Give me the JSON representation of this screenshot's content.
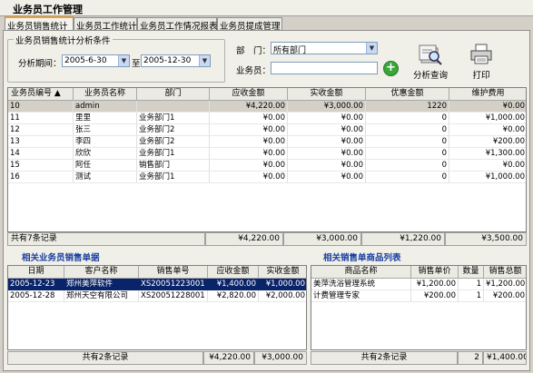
{
  "window": {
    "title": "业务员工作管理"
  },
  "tabs": [
    "业务员销售统计",
    "业务员工作统计",
    "业务员工作情况报表",
    "业务员提成管理"
  ],
  "filter": {
    "group_label": "业务员销售统计分析条件",
    "period_label": "分析期间：",
    "date_from": "2005-6-30",
    "to_label": "至",
    "date_to": "2005-12-30",
    "dept_label": "部　门：",
    "dept_value": "所有部门",
    "salesman_label": "业务员：",
    "salesman_value": "",
    "analyze_label": "分析查询",
    "print_label": "打印"
  },
  "main_table": {
    "headers": [
      "业务员编号",
      "业务员名称",
      "部门",
      "应收金额",
      "实收金额",
      "优惠金额",
      "维护费用"
    ],
    "rows": [
      [
        "10",
        "admin",
        "",
        "¥4,220.00",
        "¥3,000.00",
        "1220",
        "¥0.00"
      ],
      [
        "11",
        "里里",
        "业务部门1",
        "¥0.00",
        "¥0.00",
        "0",
        "¥1,000.00"
      ],
      [
        "12",
        "张三",
        "业务部门2",
        "¥0.00",
        "¥0.00",
        "0",
        "¥0.00"
      ],
      [
        "13",
        "李四",
        "业务部门2",
        "¥0.00",
        "¥0.00",
        "0",
        "¥200.00"
      ],
      [
        "14",
        "欣欣",
        "业务部门1",
        "¥0.00",
        "¥0.00",
        "0",
        "¥1,300.00"
      ],
      [
        "15",
        "阿任",
        "销售部门",
        "¥0.00",
        "¥0.00",
        "0",
        "¥0.00"
      ],
      [
        "16",
        "测试",
        "业务部门1",
        "¥0.00",
        "¥0.00",
        "0",
        "¥1,000.00"
      ]
    ],
    "footer": [
      "共有7条记录",
      "¥4,220.00",
      "¥3,000.00",
      "¥1,220.00",
      "¥3,500.00"
    ]
  },
  "left_table": {
    "title": "相关业务员销售单据",
    "headers": [
      "日期",
      "客户名称",
      "销售单号",
      "应收金额",
      "实收金额"
    ],
    "rows": [
      [
        "2005-12-23",
        "郑州美萍软件",
        "XS20051223001",
        "¥1,400.00",
        "¥1,000.00"
      ],
      [
        "2005-12-28",
        "郑州天空有限公司",
        "XS20051228001",
        "¥2,820.00",
        "¥2,000.00"
      ]
    ],
    "footer": [
      "共有2条记录",
      "¥4,220.00",
      "¥3,000.00"
    ]
  },
  "right_table": {
    "title": "相关销售单商品列表",
    "headers": [
      "商品名称",
      "销售单价",
      "数量",
      "销售总额"
    ],
    "rows": [
      [
        "美萍洗浴管理系统",
        "¥1,200.00",
        "1",
        "¥1,200.00"
      ],
      [
        "计费管理专家",
        "¥200.00",
        "1",
        "¥200.00"
      ]
    ],
    "footer": [
      "共有2条记录",
      "2",
      "¥1,400.00"
    ]
  }
}
